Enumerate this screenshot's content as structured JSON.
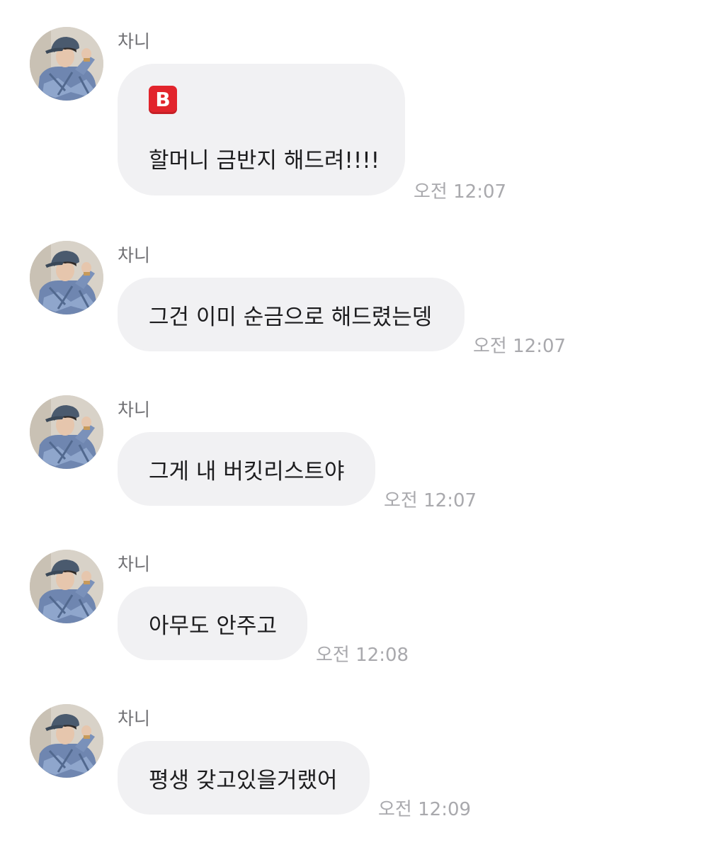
{
  "messages": [
    {
      "sender": "차니",
      "emoji": "🅱️",
      "emoji_letter": "B",
      "text": "할머니 금반지 해드려!!!!",
      "time": "오전 12:07"
    },
    {
      "sender": "차니",
      "text": "그건 이미 순금으로 해드렸는뎅",
      "time": "오전 12:07"
    },
    {
      "sender": "차니",
      "text": "그게 내 버킷리스트야",
      "time": "오전 12:07"
    },
    {
      "sender": "차니",
      "text": "아무도 안주고",
      "time": "오전 12:08"
    },
    {
      "sender": "차니",
      "text": "평생 갖고있을거랬어",
      "time": "오전 12:09"
    }
  ],
  "colors": {
    "bubble": "#f1f1f3",
    "sender": "#6f6f73",
    "time": "#a9a9ad",
    "emoji_red": "#e2242c"
  }
}
